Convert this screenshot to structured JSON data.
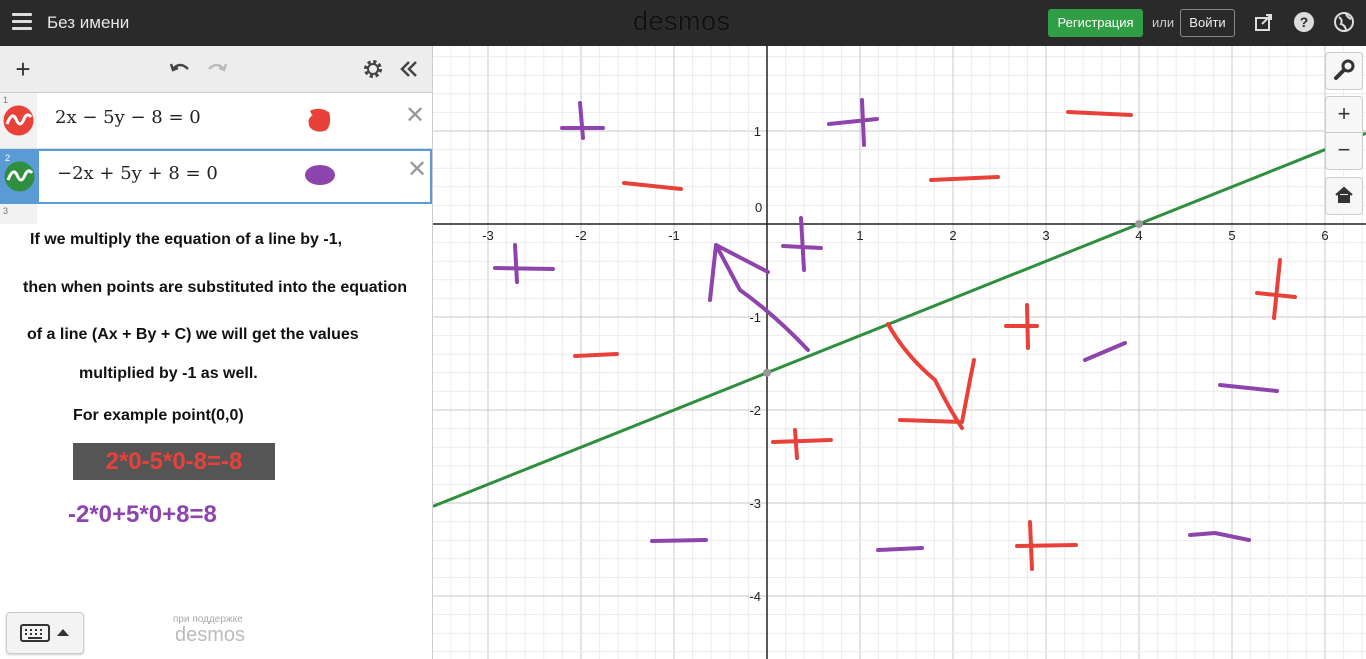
{
  "app": {
    "title": "Без имени",
    "logo": "desmos",
    "register_label": "Регистрация",
    "or_label": "или",
    "login_label": "Войти",
    "icons": [
      "menu-icon",
      "share-icon",
      "help-icon",
      "language-icon"
    ]
  },
  "toolbar": {
    "icons": [
      "add-icon",
      "undo-icon",
      "redo-icon",
      "settings-icon",
      "collapse-icon"
    ]
  },
  "expressions": [
    {
      "index": "1",
      "latex": "2x − 5y − 8 = 0",
      "color": "#e8413a"
    },
    {
      "index": "2",
      "latex": "−2x + 5y + 8 = 0",
      "color": "#2f8f3f"
    },
    {
      "index": "3",
      "latex": ""
    }
  ],
  "notes": [
    "If we multiply the equation of a line by -1,",
    "then when points are substituted into the equation",
    "of a line (Ax + By + C) we will get the values",
    "multiplied by -1 as well.",
    "For example point(0,0)"
  ],
  "examples": {
    "red": "2*0-5*0-8=-8",
    "purple": "-2*0+5*0+8=8"
  },
  "footer": {
    "powered_by": "при поддержке",
    "powered_logo": "desmos"
  },
  "graph": {
    "x_ticks": [
      "-3",
      "-2",
      "-1",
      "1",
      "2",
      "3",
      "4",
      "5",
      "6"
    ],
    "y_ticks": [
      "1",
      "-1",
      "-2",
      "-3",
      "-4"
    ],
    "origin_label": "0",
    "line_color": "#2f8f3f",
    "red_color": "#e8413a",
    "purple_color": "#8e44ad",
    "side_buttons": [
      "wrench-icon",
      "zoom-in-icon",
      "zoom-out-icon",
      "home-icon"
    ]
  }
}
